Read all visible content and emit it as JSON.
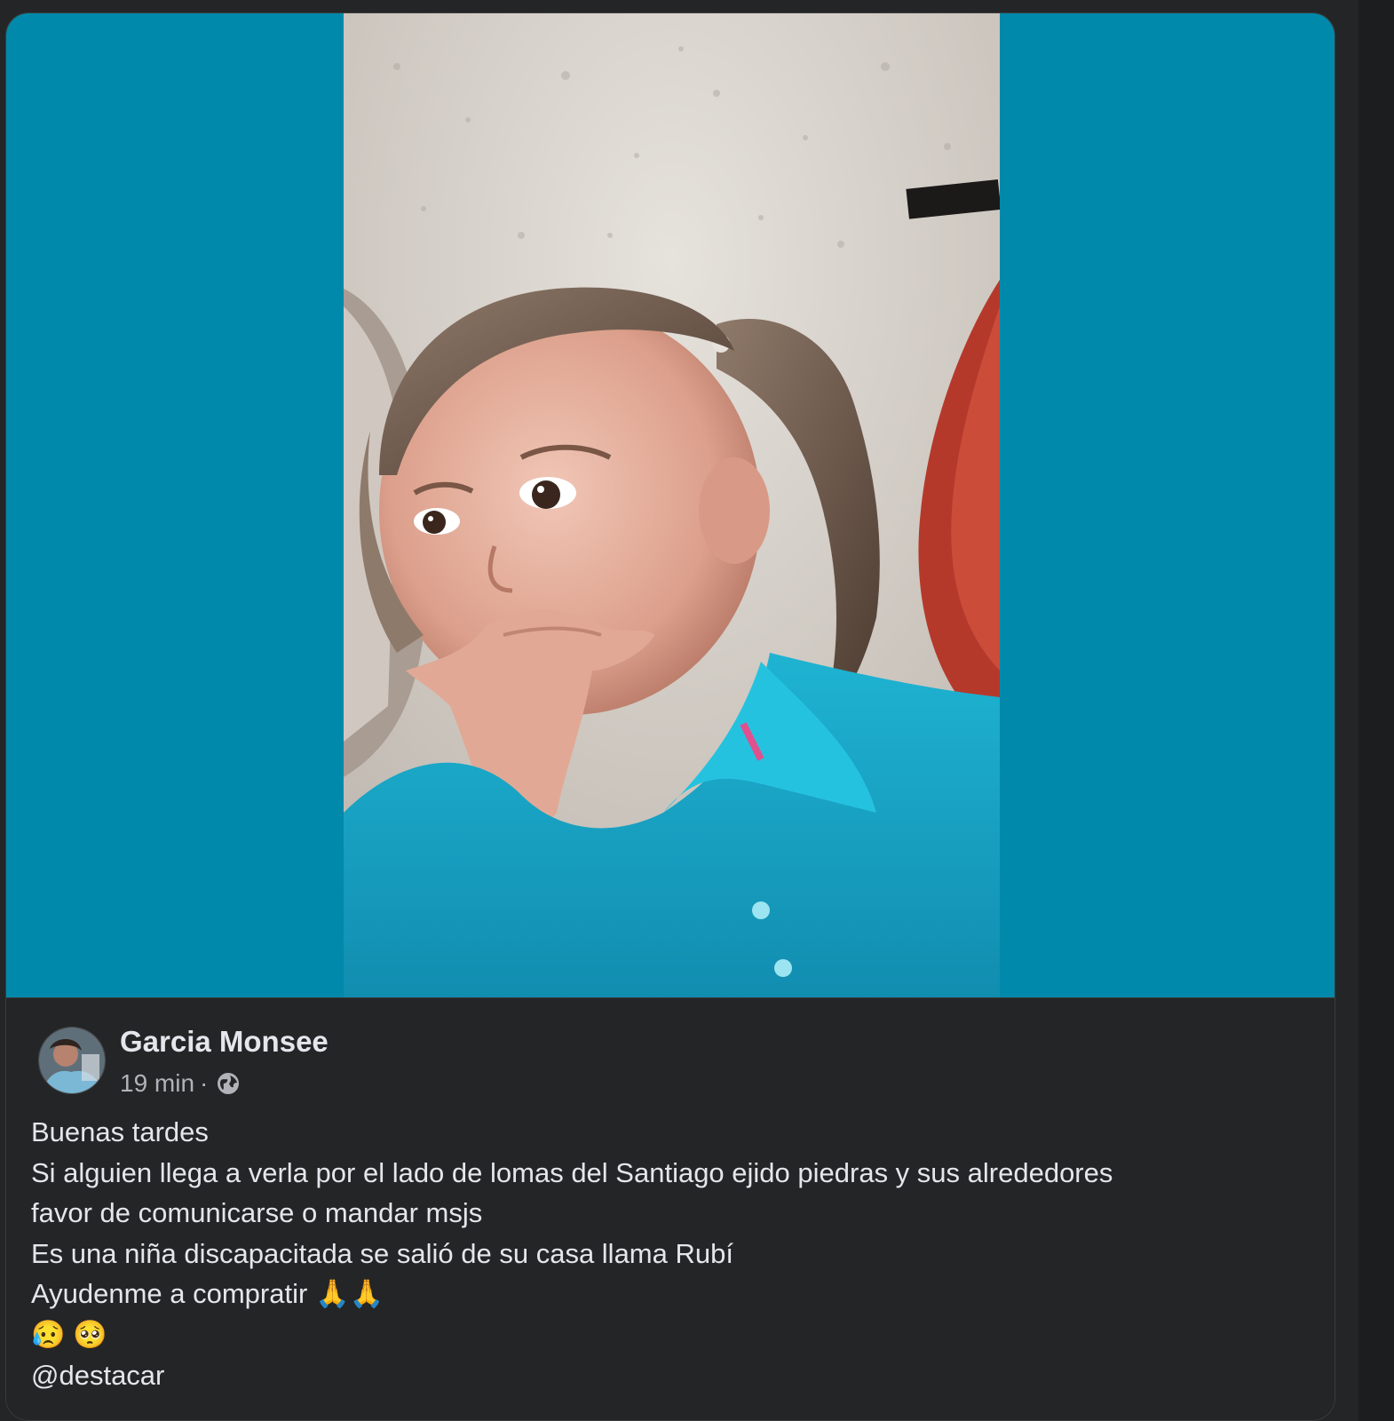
{
  "post": {
    "author": "Garcia Monsee",
    "time": "19 min",
    "separator": "·",
    "privacy_icon": "globe-icon",
    "text_lines": [
      "Buenas tardes",
      "Si alguien llega a verla por el lado de lomas del Santiago ejido piedras y sus alrededores",
      "favor de comunicarse o mandar msjs",
      "Es una niña discapacitada se salió de su casa  llama Rubí",
      "Ayudenme a compratir"
    ],
    "prayer_emojis": [
      "🙏",
      "🙏"
    ],
    "face_emojis": [
      "😥",
      "🥺"
    ],
    "mention": "@destacar"
  },
  "media": {
    "background_color": "#0089aa",
    "photo_subject": "girl-in-turquoise-shirt"
  },
  "colors": {
    "card_bg": "#242526",
    "text_primary": "#e4e6eb",
    "text_secondary": "#b0b3b8"
  }
}
